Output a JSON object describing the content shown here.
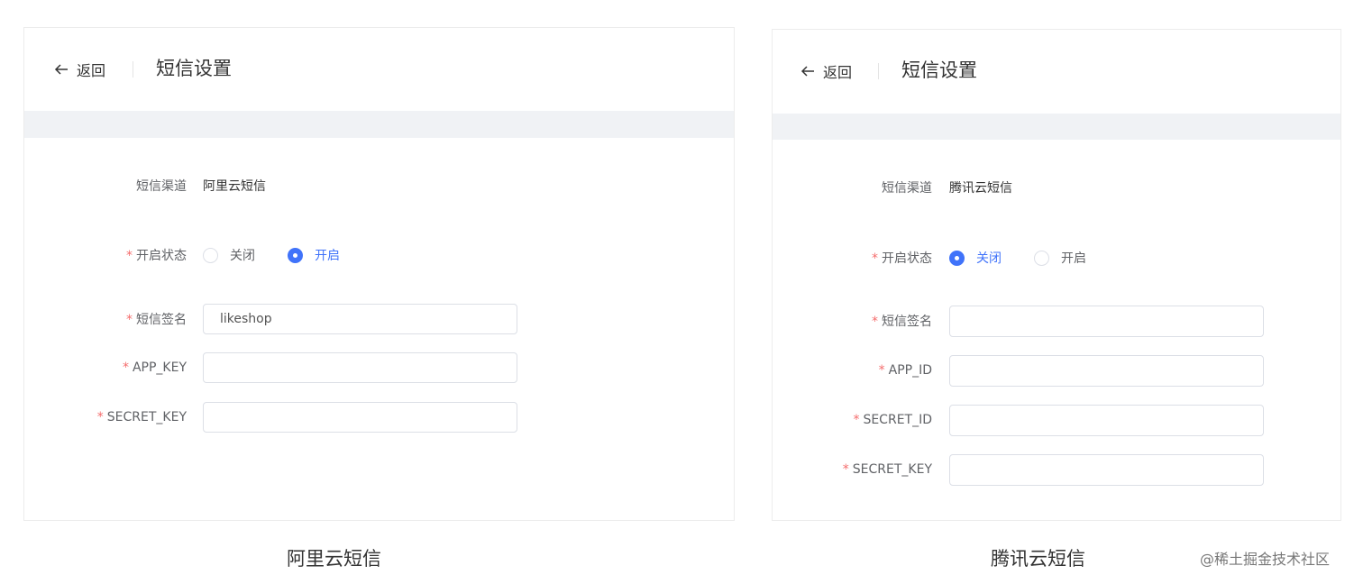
{
  "left": {
    "back_label": "返回",
    "title": "短信设置",
    "channel_label": "短信渠道",
    "channel_value": "阿里云短信",
    "status_label": "开启状态",
    "status_options": [
      "关闭",
      "开启"
    ],
    "status_selected": "开启",
    "fields": [
      {
        "label": "短信签名",
        "value": "likeshop"
      },
      {
        "label": "APP_KEY",
        "value": ""
      },
      {
        "label": "SECRET_KEY",
        "value": ""
      }
    ],
    "caption": "阿里云短信"
  },
  "right": {
    "back_label": "返回",
    "title": "短信设置",
    "channel_label": "短信渠道",
    "channel_value": "腾讯云短信",
    "status_label": "开启状态",
    "status_options": [
      "关闭",
      "开启"
    ],
    "status_selected": "关闭",
    "fields": [
      {
        "label": "短信签名",
        "value": ""
      },
      {
        "label": "APP_ID",
        "value": ""
      },
      {
        "label": "SECRET_ID",
        "value": ""
      },
      {
        "label": "SECRET_KEY",
        "value": ""
      }
    ],
    "caption": "腾讯云短信"
  },
  "required_mark": "*",
  "watermark": "@稀土掘金技术社区",
  "colors": {
    "accent": "#4073fa",
    "required": "#f56c6c",
    "page_bg": "#f0f2f5"
  }
}
